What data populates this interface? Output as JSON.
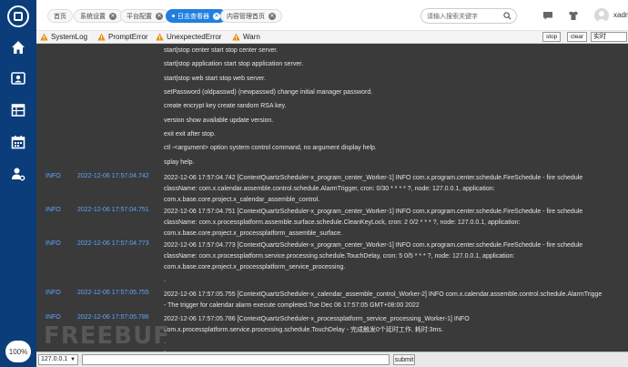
{
  "sidebar": {
    "icons": [
      "logo-icon",
      "home-icon",
      "user-card-icon",
      "table-icon",
      "calendar-icon",
      "user-settings-icon"
    ],
    "zoom": "100%"
  },
  "tabs": [
    {
      "label": "首页"
    },
    {
      "label": "系统设置"
    },
    {
      "label": "平台配置"
    },
    {
      "label": "日志查看器"
    },
    {
      "label": "内容管理首页"
    }
  ],
  "search": {
    "placeholder": "请输入搜索关键字"
  },
  "user": {
    "name": "xadm"
  },
  "log_tabs": [
    "SystemLog",
    "PromptError",
    "UnexpectedError",
    "Warn"
  ],
  "log_buttons": {
    "stop": "stop",
    "clear": "clear",
    "mode": "实时"
  },
  "help_lines": [
    "start|stop center start stop center server.",
    "start|stop application start stop application server.",
    "start|stop web start stop web server.",
    "setPassword (oldpasswd) (newpasswd) change initial manager password.",
    "create encrypt key create random RSA key.",
    "version show available update version.",
    "exit exit after stop.",
    "ctl -<argument> option system control command, no argument display help.",
    "splay help."
  ],
  "entries": [
    {
      "level": "INFO",
      "time": "2022-12-06 17:57:04.742",
      "lines": [
        "2022-12-06 17:57:04.742 [ContextQuartzScheduler-x_program_center_Worker-1] INFO com.x.program.center.schedule.FireSchedule - fire schedule",
        "className: com.x.calendar.assemble.control.schedule.AlarmTrigger, cron: 0/30 * * * * ?, node: 127.0.0.1, application:",
        "com.x.base.core.project.x_calendar_assemble_control."
      ]
    },
    {
      "level": "INFO",
      "time": "2022-12-06 17:57:04.751",
      "lines": [
        "2022-12-06 17:57:04.751 [ContextQuartzScheduler-x_program_center_Worker-1] INFO com.x.program.center.schedule.FireSchedule - fire schedule",
        "className: com.x.processplatform.assemble.surface.schedule.CleanKeyLock, cron: 2 0/2 * * * ?, node: 127.0.0.1, application:",
        "com.x.base.core.project.x_processplatform_assemble_surface."
      ]
    },
    {
      "level": "INFO",
      "time": "2022-12-06 17:57:04.773",
      "lines": [
        "2022-12-06 17:57:04.773 [ContextQuartzScheduler-x_program_center_Worker-1] INFO com.x.program.center.schedule.FireSchedule - fire schedule",
        "className: com.x.processplatform.service.processing.schedule.TouchDelay, cron: 5 0/5 * * * ?, node: 127.0.0.1, application:",
        "com.x.base.core.project.x_processplatform_service_processing."
      ]
    },
    {
      "level": "INFO",
      "time": "2022-12-06 17:57:05.755",
      "lines": [
        "2022-12-06 17:57:05.755 [ContextQuartzScheduler-x_calendar_assemble_control_Worker-2] INFO com.x.calendar.assemble.control.schedule.AlarmTrigge",
        "- The trigger for calendar alarm execute completed.Tue Dec 06 17:57:05 GMT+08:00 2022"
      ]
    },
    {
      "level": "INFO",
      "time": "2022-12-06 17:57:05.786",
      "lines": [
        "2022-12-06 17:57:05.786 [ContextQuartzScheduler-x_processplatform_service_processing_Worker-1] INFO",
        "com.x.processplatform.service.processing.schedule.TouchDelay - 完成触发0个延时工作, 耗时:3ms."
      ]
    }
  ],
  "dots": [
    ".",
    ".",
    "."
  ],
  "watermark": "FREEBUF",
  "command": {
    "node": "127.0.0.1",
    "input": "",
    "submit": "submit"
  }
}
